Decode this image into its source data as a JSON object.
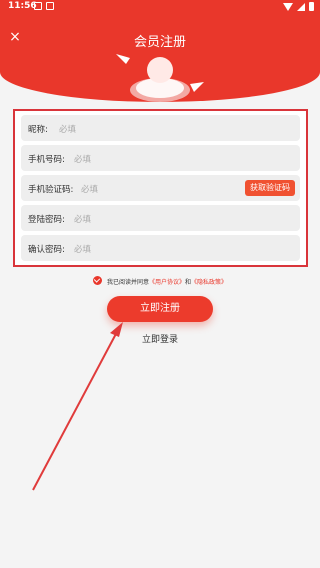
{
  "status_bar": {
    "time": "11:56"
  },
  "header": {
    "title": "会员注册",
    "close_symbol": "×"
  },
  "form": {
    "fields": [
      {
        "label": "昵称:",
        "placeholder": "必填"
      },
      {
        "label": "手机号码:",
        "placeholder": "必填"
      },
      {
        "label": "手机验证码:",
        "placeholder": "必填"
      },
      {
        "label": "登陆密码:",
        "placeholder": "必填"
      },
      {
        "label": "确认密码:",
        "placeholder": "必填"
      }
    ],
    "get_code_label": "获取验证码"
  },
  "agreement": {
    "checked": true,
    "prefix": "我已阅读并同意",
    "user_agreement": "《用户协议》",
    "conjunction": "和",
    "privacy_policy": "《隐私政策》"
  },
  "actions": {
    "register_label": "立即注册",
    "login_label": "立即登录"
  },
  "colors": {
    "brand_red": "#e9372b",
    "highlight_frame": "#d9343a",
    "field_bg": "#eeeeee",
    "page_bg": "#f4f4f4"
  },
  "icons": [
    "close-icon",
    "wifi-icon",
    "signal-icon",
    "battery-icon",
    "checkmark-icon"
  ]
}
